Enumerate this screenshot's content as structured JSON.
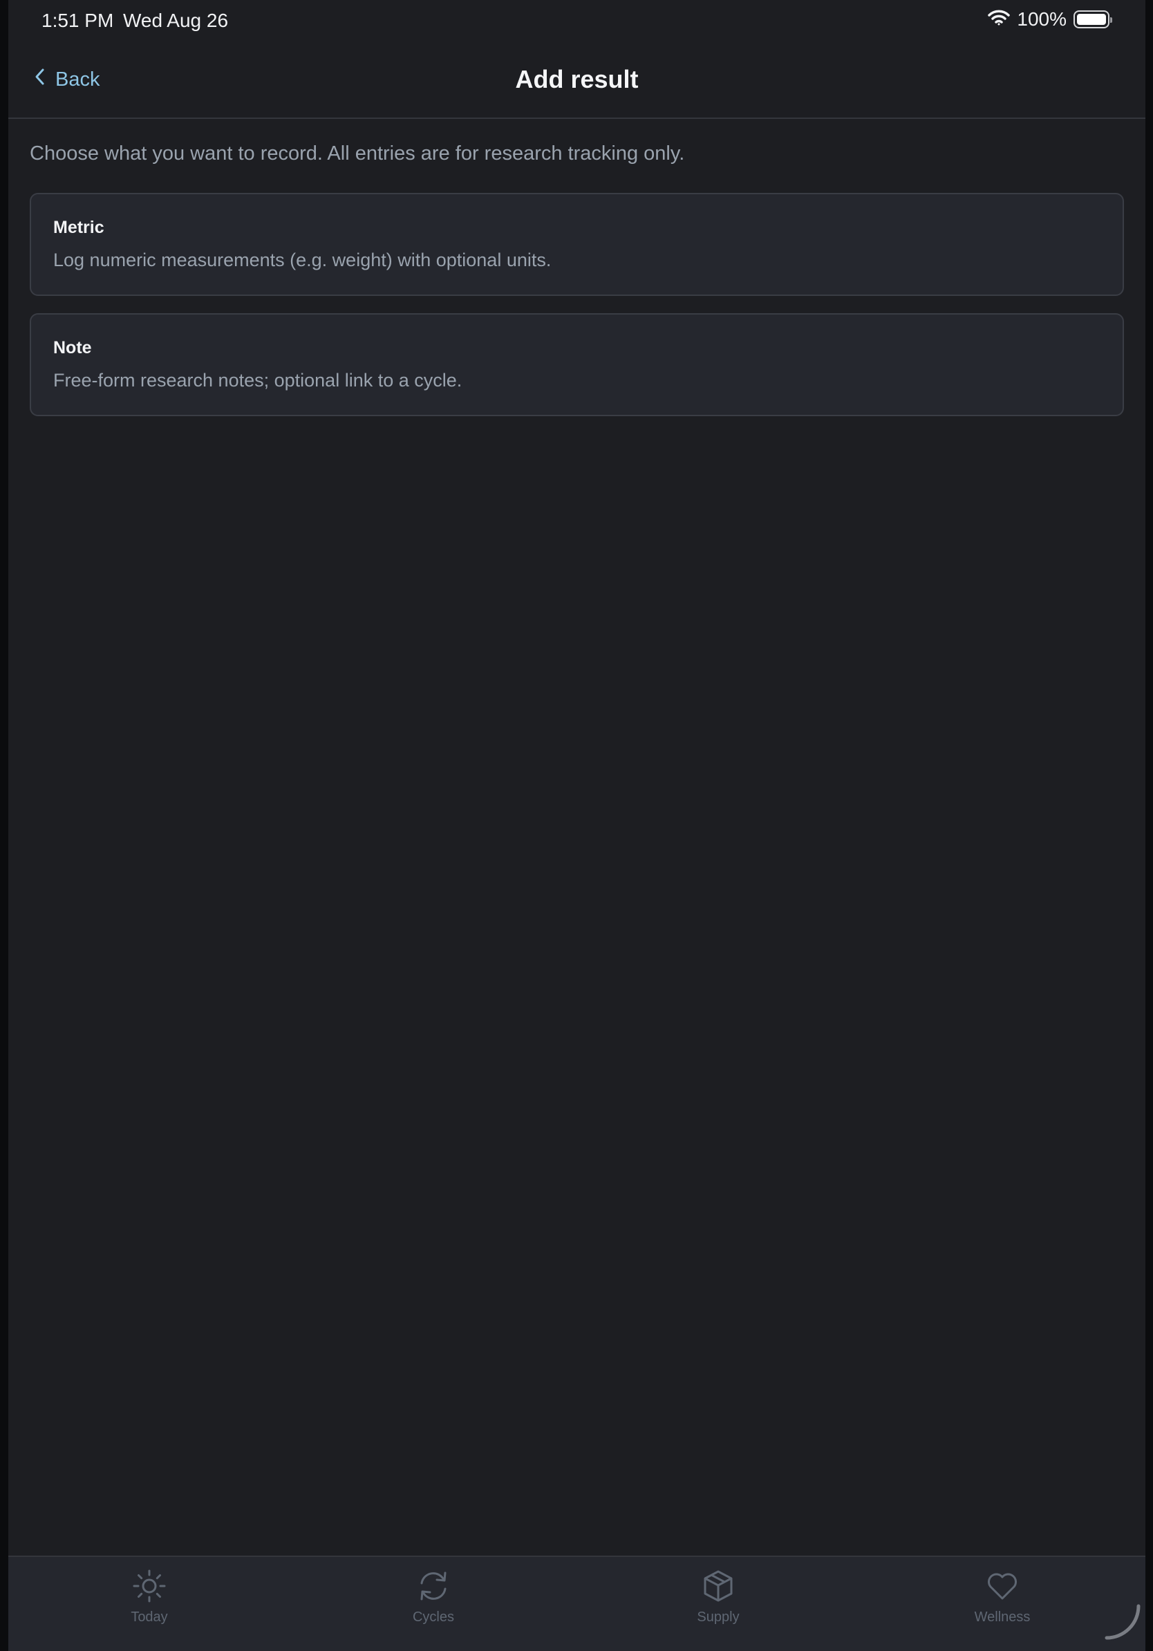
{
  "status_bar": {
    "time": "1:51 PM",
    "date": "Wed Aug 26",
    "battery_text": "100%",
    "battery_level": 1.0
  },
  "header": {
    "back_label": "Back",
    "title": "Add result"
  },
  "intro": "Choose what you want to record. All entries are for research tracking only.",
  "options": [
    {
      "title": "Metric",
      "description": "Log numeric measurements (e.g. weight) with optional units."
    },
    {
      "title": "Note",
      "description": "Free-form research notes; optional link to a cycle."
    }
  ],
  "tabs": [
    {
      "label": "Today",
      "icon": "sun-icon"
    },
    {
      "label": "Cycles",
      "icon": "refresh-icon"
    },
    {
      "label": "Supply",
      "icon": "box-icon"
    },
    {
      "label": "Wellness",
      "icon": "heart-icon"
    }
  ],
  "colors": {
    "background": "#1d1e22",
    "card": "#25272e",
    "accent": "#8ec6e6",
    "muted_text": "#9aa3ae",
    "tab_inactive": "#5f6773"
  }
}
